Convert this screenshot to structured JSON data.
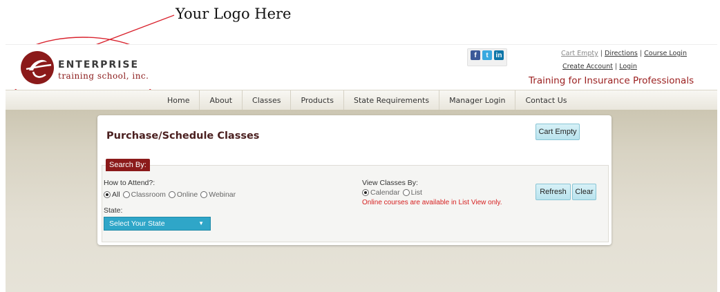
{
  "annotation": {
    "text": "Your Logo Here"
  },
  "logo": {
    "name": "ENTERPRISE",
    "subtitle": "training school, inc."
  },
  "social": [
    {
      "icon": "facebook-icon",
      "glyph": "f"
    },
    {
      "icon": "twitter-icon",
      "glyph": "t"
    },
    {
      "icon": "linkedin-icon",
      "glyph": "in"
    }
  ],
  "top_links": {
    "cart": "Cart Empty",
    "directions": "Directions",
    "course_login": "Course Login",
    "create_account": "Create Account",
    "login": "Login",
    "separator": "|"
  },
  "tagline": "Training for Insurance Professionals",
  "nav": [
    "Home",
    "About",
    "Classes",
    "Products",
    "State Requirements",
    "Manager Login",
    "Contact Us"
  ],
  "page": {
    "title": "Purchase/Schedule Classes",
    "cart_button": "Cart Empty",
    "search_by": "Search By:",
    "attend_label": "How to Attend?:",
    "attend_options": [
      "All",
      "Classroom",
      "Online",
      "Webinar"
    ],
    "attend_selected": "All",
    "state_label": "State:",
    "state_select": "Select Your State",
    "view_label": "View Classes By:",
    "view_options": [
      "Calendar",
      "List"
    ],
    "view_selected": "Calendar",
    "view_note": "Online courses are available in List View only.",
    "refresh_button": "Refresh",
    "clear_button": "Clear"
  },
  "colors": {
    "brand_red": "#8b1a1a",
    "accent_blue": "#2fa6c8",
    "note_red": "#d62020"
  }
}
